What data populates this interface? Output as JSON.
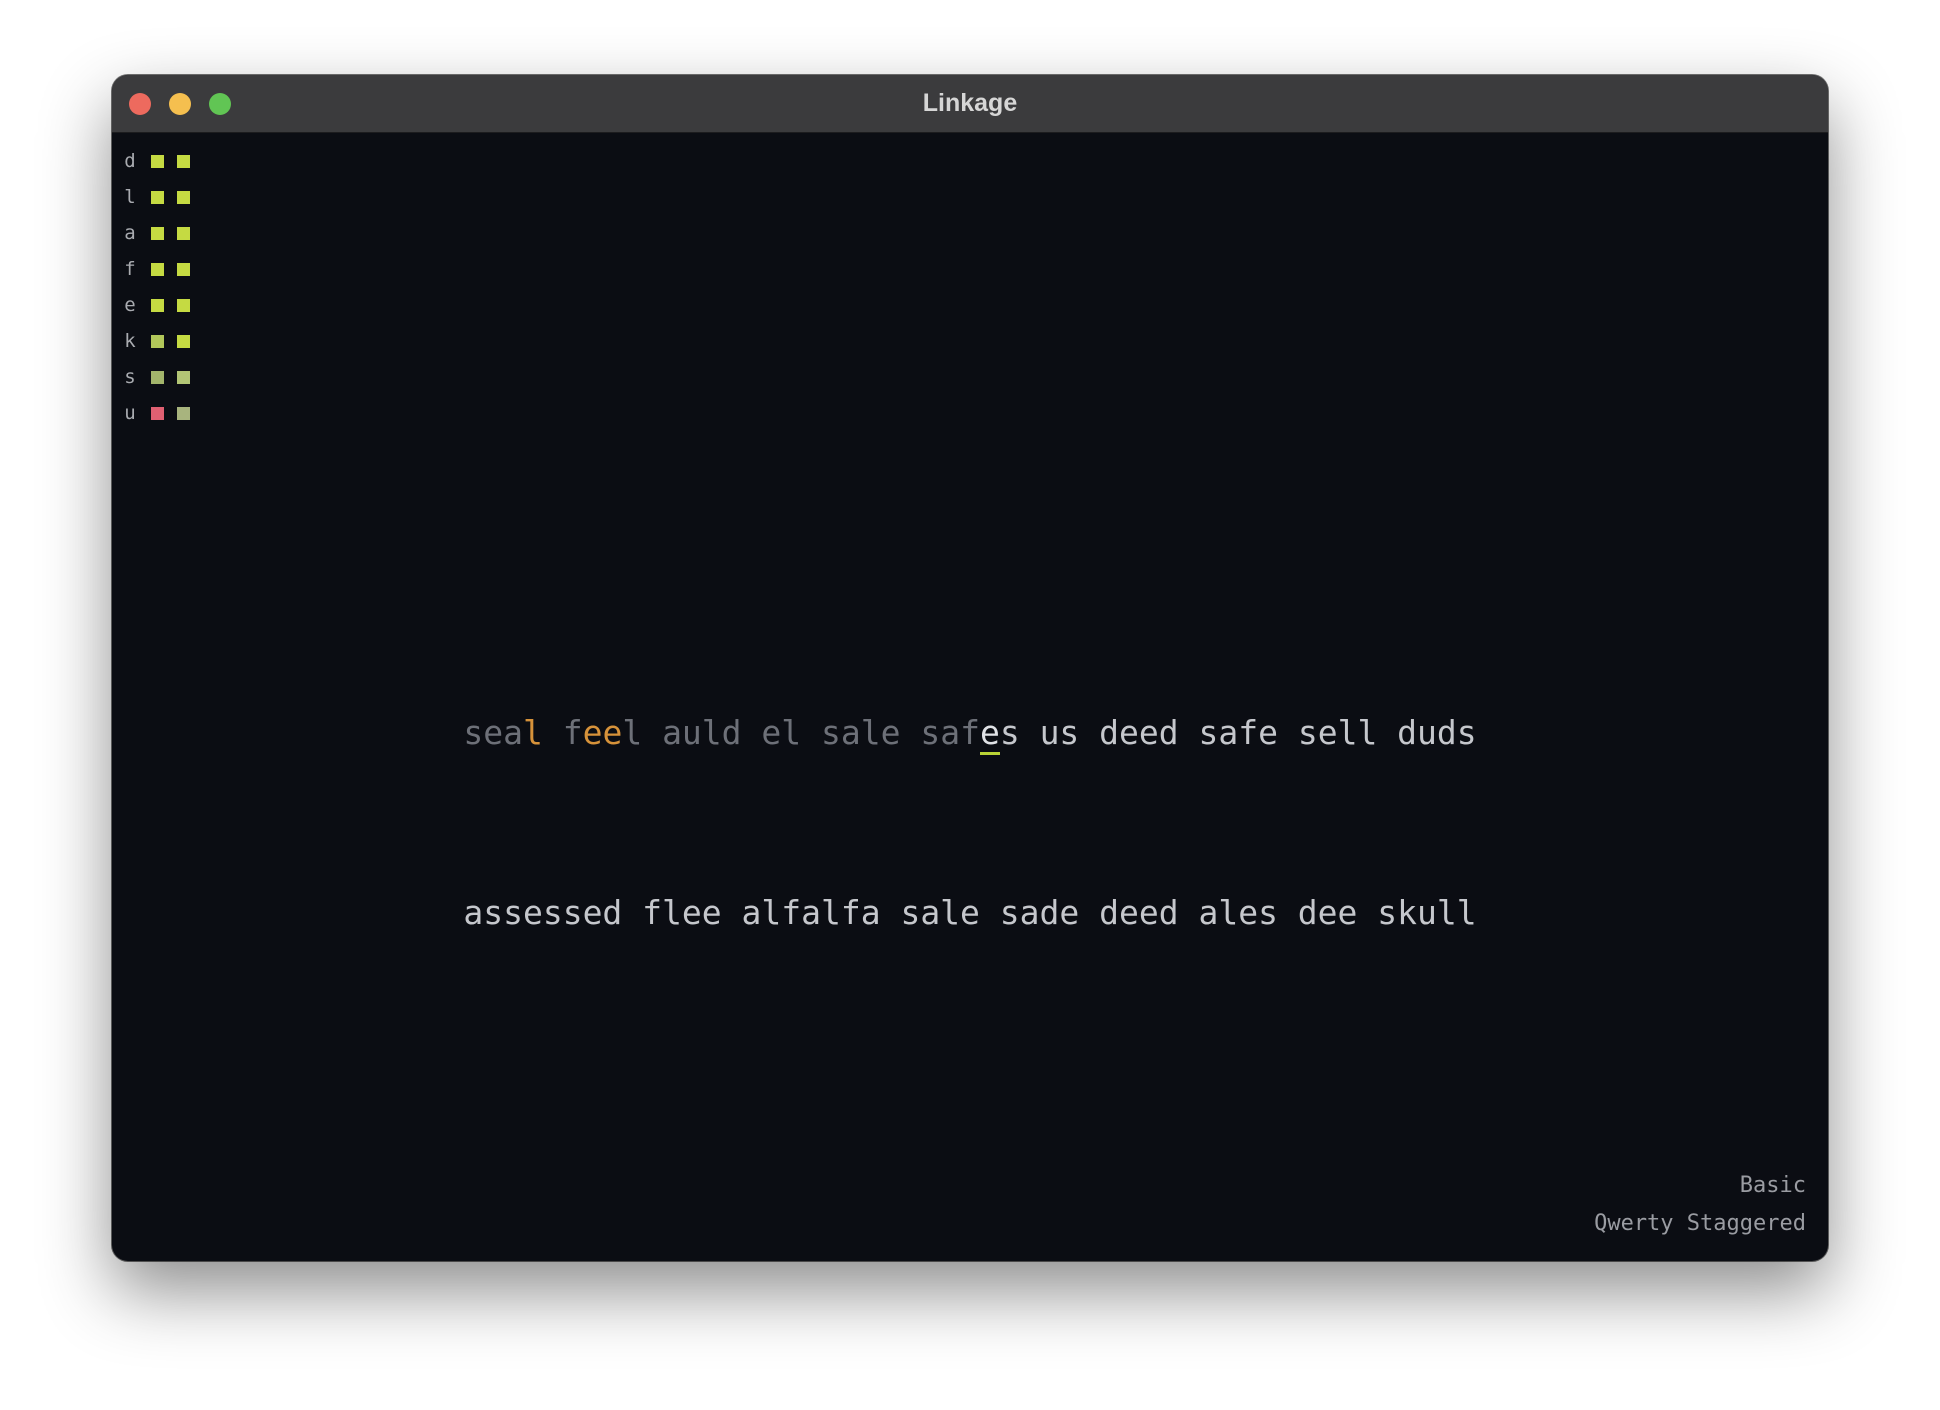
{
  "window": {
    "title": "Linkage"
  },
  "key_stats": [
    {
      "letter": "d",
      "colors": [
        "#c5da42",
        "#c5da42"
      ]
    },
    {
      "letter": "l",
      "colors": [
        "#c5da42",
        "#c5da42"
      ]
    },
    {
      "letter": "a",
      "colors": [
        "#c5da42",
        "#c5da42"
      ]
    },
    {
      "letter": "f",
      "colors": [
        "#c5da42",
        "#c5da42"
      ]
    },
    {
      "letter": "e",
      "colors": [
        "#c5da42",
        "#c5da42"
      ]
    },
    {
      "letter": "k",
      "colors": [
        "#b2c75a",
        "#c5da42"
      ]
    },
    {
      "letter": "s",
      "colors": [
        "#a3b56b",
        "#b2c575"
      ]
    },
    {
      "letter": "u",
      "colors": [
        "#e06072",
        "#a8b47e"
      ]
    }
  ],
  "practice": {
    "line1": {
      "typed_segments": [
        {
          "text": "sea",
          "state": "typed"
        },
        {
          "text": "l",
          "state": "error"
        },
        {
          "text": " f",
          "state": "typed"
        },
        {
          "text": "ee",
          "state": "error"
        },
        {
          "text": "l auld el sale saf",
          "state": "typed"
        }
      ],
      "cursor_char": "e",
      "pending": "s us deed safe sell duds"
    },
    "line2": "assessed flee alfalfa sale sade deed ales dee skull"
  },
  "footer": {
    "mode": "Basic",
    "layout": "Qwerty Staggered"
  },
  "colors": {
    "background": "#0b0d13",
    "titlebar": "#3b3b3d",
    "cursor_underline": "#b9d336",
    "error_text": "#d6923a"
  }
}
